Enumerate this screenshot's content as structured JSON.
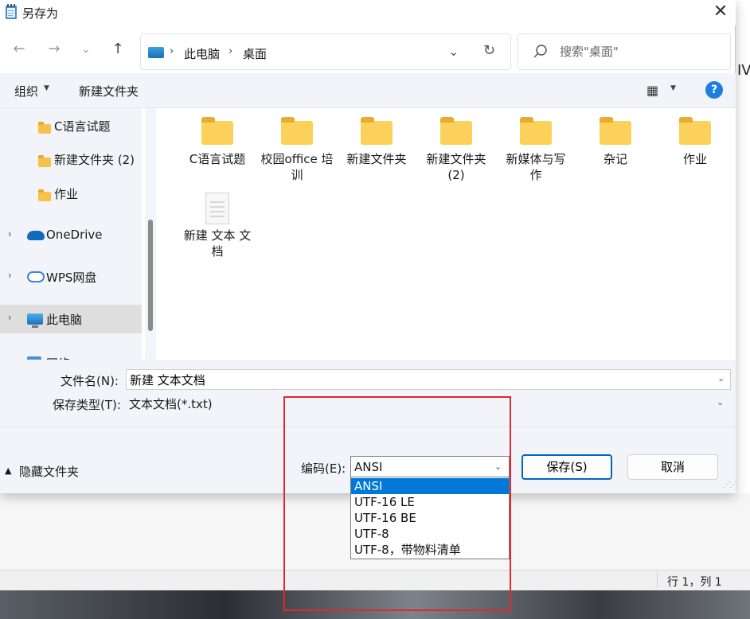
{
  "background": {
    "edge_text": "IV",
    "status_position": "行 1，列 1"
  },
  "dialog": {
    "title": "另存为",
    "close_glyph": "✕"
  },
  "nav": {
    "back": "←",
    "forward": "→",
    "recent": "⌄",
    "up": "↑",
    "breadcrumbs": [
      "此电脑",
      "桌面"
    ],
    "crumb_sep": "›",
    "dropdown": "⌄",
    "refresh": "↻",
    "search_placeholder": "搜索\"桌面\""
  },
  "toolbar": {
    "organize": "组织",
    "new_folder": "新建文件夹",
    "view_glyph": "▦",
    "help": "?"
  },
  "sidebar": {
    "items": [
      {
        "label": "C语言试题",
        "type": "folder"
      },
      {
        "label": "新建文件夹 (2)",
        "type": "folder"
      },
      {
        "label": "作业",
        "type": "folder"
      },
      {
        "label": "OneDrive",
        "type": "onedrive"
      },
      {
        "label": "WPS网盘",
        "type": "wps"
      },
      {
        "label": "此电脑",
        "type": "pc",
        "selected": true
      },
      {
        "label": "网络",
        "type": "network"
      }
    ]
  },
  "files": [
    {
      "label": "C语言试题",
      "type": "folder"
    },
    {
      "label": "校园office 培训",
      "type": "folder"
    },
    {
      "label": "新建文件夹",
      "type": "folder"
    },
    {
      "label": "新建文件夹 (2)",
      "type": "folder"
    },
    {
      "label": "新媒体与写 作",
      "type": "folder"
    },
    {
      "label": "杂记",
      "type": "folder"
    },
    {
      "label": "作业",
      "type": "folder"
    },
    {
      "label": "新建 文本 文档",
      "type": "text"
    }
  ],
  "form": {
    "filename_label": "文件名(N):",
    "filename_value": "新建 文本文档",
    "filetype_label": "保存类型(T):",
    "filetype_value": "文本文档(*.txt)",
    "hide_folders": "隐藏文件夹",
    "encoding_label": "编码(E):",
    "encoding_value": "ANSI",
    "encoding_options": [
      "ANSI",
      "UTF-16 LE",
      "UTF-16 BE",
      "UTF-8",
      "UTF-8，带物料清单"
    ],
    "save": "保存(S)",
    "cancel": "取消"
  },
  "colors": {
    "accent": "#0067c0",
    "selection": "#0078d7",
    "annotation": "#e0282e",
    "folder": "#fcd15a"
  }
}
